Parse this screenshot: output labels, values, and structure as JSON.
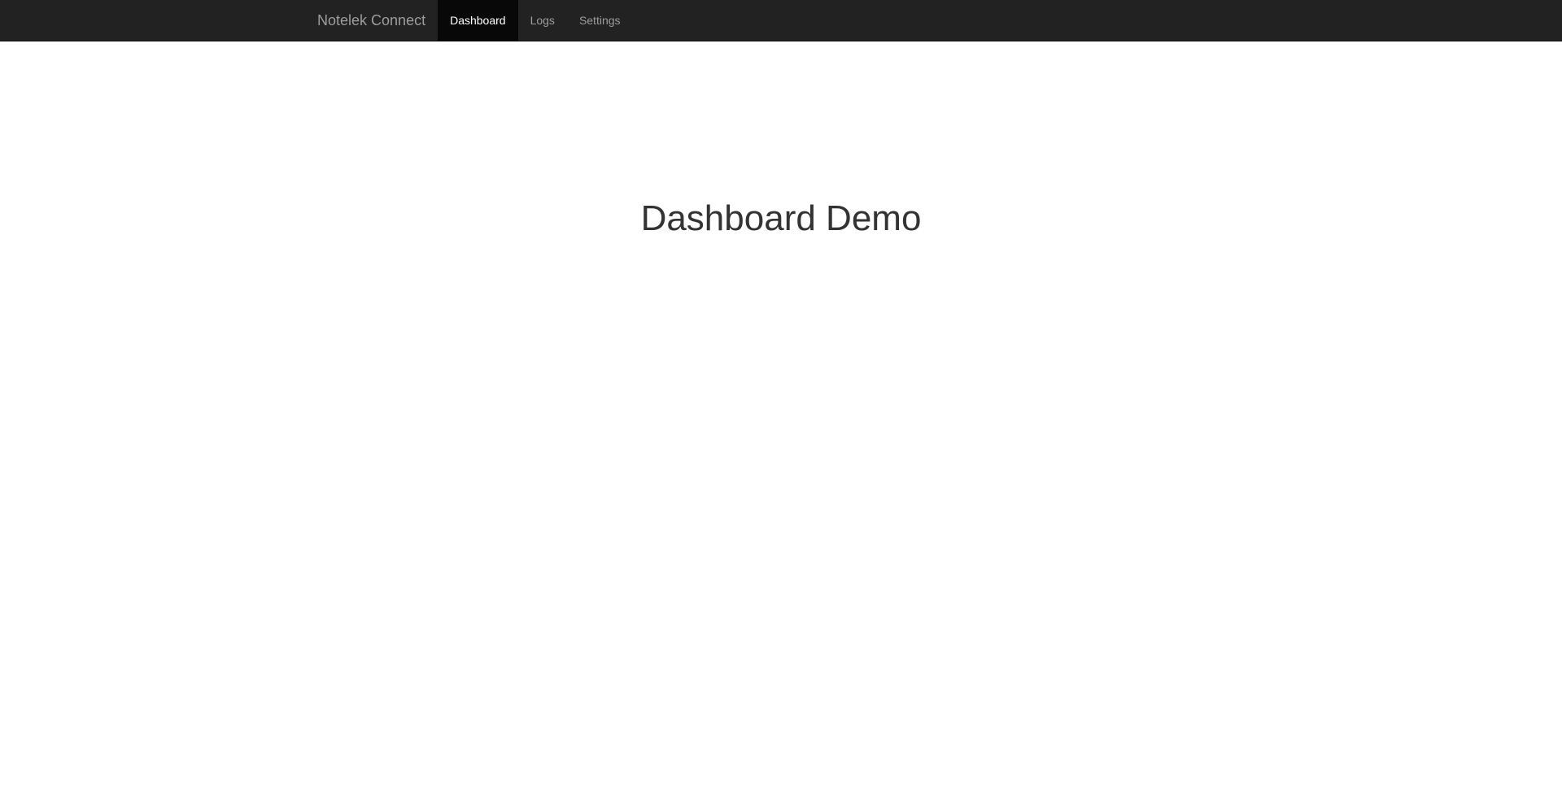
{
  "navbar": {
    "brand": "Notelek Connect",
    "items": [
      {
        "label": "Dashboard",
        "active": true
      },
      {
        "label": "Logs",
        "active": false
      },
      {
        "label": "Settings",
        "active": false
      }
    ]
  },
  "main": {
    "title": "Dashboard Demo"
  },
  "colors": {
    "navbar_bg": "#222222",
    "active_item_bg": "#080808",
    "nav_text": "#9d9d9d",
    "active_text": "#ffffff",
    "title_text": "#333333"
  }
}
